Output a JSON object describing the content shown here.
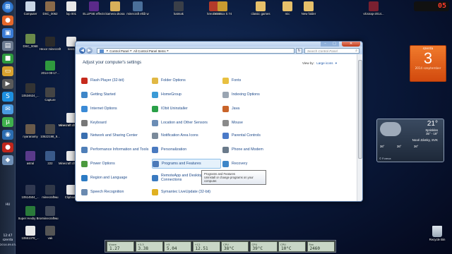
{
  "taskbar": {
    "clock_time": "12:47",
    "clock_day": "szerda",
    "clock_date": "2014.09.03.",
    "lang": "HU"
  },
  "desktop_icons": [
    {
      "label": "Computer"
    },
    {
      "label": "DSC_0062"
    },
    {
      "label": "lop 001"
    },
    {
      "label": "ELLIPSE effects"
    },
    {
      "label": "kamera okosa"
    },
    {
      "label": "minecraft eltűt w"
    },
    {
      "label": "katmak"
    },
    {
      "label": "kreszteszt"
    },
    {
      "label": "DOSBox 0.74"
    },
    {
      "label": "classic games"
    },
    {
      "label": "mic"
    },
    {
      "label": "New folder"
    },
    {
      "label": "vlcsnap-2014..."
    },
    {
      "label": "DSC_0068"
    },
    {
      "label": "Hexor minecraft"
    },
    {
      "label": "kiss1"
    },
    {
      "label": "Capture"
    },
    {
      "label": "Minecraft choos yo"
    },
    {
      "label": "2014-08-17..."
    },
    {
      "label": "10534624_..."
    },
    {
      "label": "nyaranamy"
    },
    {
      "label": "10622198_9..."
    },
    {
      "label": "Minecraft choos yo"
    },
    {
      "label": "astral"
    },
    {
      "label": "222"
    },
    {
      "label": "Minecraft choos yo"
    },
    {
      "label": "10514504_..."
    },
    {
      "label": "minecraftwu"
    },
    {
      "label": "Clipboard"
    },
    {
      "label": "Super Hexby Bros"
    },
    {
      "label": "minecraftwu"
    },
    {
      "label": "10551378_..."
    },
    {
      "label": "vak"
    }
  ],
  "window": {
    "address": [
      "Control Panel",
      "All Control Panel Items"
    ],
    "search_placeholder": "Search Control Panel",
    "heading": "Adjust your computer's settings",
    "view_by_label": "View by:",
    "view_by_value": "Large icons",
    "items": [
      {
        "label": "Flash Player (32-bit)"
      },
      {
        "label": "Getting Started"
      },
      {
        "label": "Internet Options"
      },
      {
        "label": "Keyboard"
      },
      {
        "label": "Network and Sharing Center"
      },
      {
        "label": "Performance Information and Tools"
      },
      {
        "label": "Power Options"
      },
      {
        "label": "Region and Language"
      },
      {
        "label": "Speech Recognition"
      },
      {
        "label": "Folder Options"
      },
      {
        "label": "HomeGroup"
      },
      {
        "label": "IObit Uninstaller"
      },
      {
        "label": "Location and Other Sensors"
      },
      {
        "label": "Notification Area Icons"
      },
      {
        "label": "Personalization"
      },
      {
        "label": "Programs and Features"
      },
      {
        "label": "RemoteApp and Desktop Connections"
      },
      {
        "label": "Symantec LiveUpdate (32-bit)"
      },
      {
        "label": "Fonts"
      },
      {
        "label": "Indexing Options"
      },
      {
        "label": "Java"
      },
      {
        "label": "Mouse"
      },
      {
        "label": "Parental Controls"
      },
      {
        "label": "Phone and Modem"
      },
      {
        "label": "Recovery"
      },
      {
        "label": "Sync Center"
      }
    ],
    "tooltip": "Programs and Features\nUninstall or change programs on your computer."
  },
  "gadgets": {
    "clock": "05",
    "calendar_day": "szerda",
    "calendar_num": "3",
    "calendar_date": "2014 szeptember",
    "weather_temp": "21°",
    "weather_cond": "Sprinkles",
    "weather_range": "35° - 19°",
    "weather_city": "Nové Zámky, SVK",
    "weather_source": "© Foreca",
    "weather_days": [
      "36°",
      "36°",
      "36°"
    ]
  },
  "meters": [
    {
      "label": "Vcore",
      "value": "1.27"
    },
    {
      "label": "+3.3",
      "value": "3.38"
    },
    {
      "label": "+5",
      "value": "5.04"
    },
    {
      "label": "+12",
      "value": "12.51"
    },
    {
      "label": "CPU",
      "value": "38°C"
    },
    {
      "label": "CPU",
      "value": "39°C"
    },
    {
      "label": "CPU",
      "value": "10°C"
    },
    {
      "label": "Fan",
      "value": "2460"
    }
  ],
  "recycle_bin": "Recycle Bin",
  "colors": {
    "accent": "#1e4a8a",
    "calendar": "#e2621d"
  }
}
